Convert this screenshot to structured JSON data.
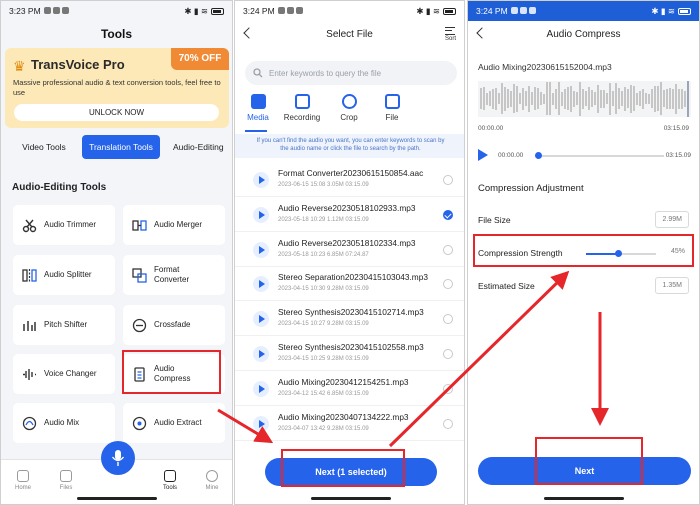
{
  "panel1": {
    "status": {
      "time": "3:23 PM",
      "battery": "battery-icon"
    },
    "title": "Tools",
    "promo": {
      "name": "TransVoice Pro",
      "badge": "70% OFF",
      "description": "Massive professional audio & text conversion tools, feel free to use",
      "button": "UNLOCK NOW"
    },
    "tabs": [
      {
        "label": "Video Tools",
        "active": false
      },
      {
        "label": "Translation Tools",
        "active": true
      },
      {
        "label": "Audio-Editing",
        "active": false
      }
    ],
    "section_heading": "Audio-Editing Tools",
    "tools": [
      {
        "label": "Audio Trimmer",
        "icon": "scissors-icon"
      },
      {
        "label": "Audio Merger",
        "icon": "merge-icon"
      },
      {
        "label": "Audio Splitter",
        "icon": "split-icon"
      },
      {
        "label": "Format Converter",
        "icon": "convert-icon"
      },
      {
        "label": "Pitch Shifter",
        "icon": "pitch-icon"
      },
      {
        "label": "Crossfade",
        "icon": "crossfade-icon"
      },
      {
        "label": "Voice Changer",
        "icon": "voice-changer-icon"
      },
      {
        "label": "Audio Compress",
        "icon": "compress-icon"
      },
      {
        "label": "Audio Mix",
        "icon": "mix-icon"
      },
      {
        "label": "Audio Extract",
        "icon": "extract-icon"
      }
    ],
    "nav": [
      {
        "label": "Home",
        "active": false
      },
      {
        "label": "Files",
        "active": false
      },
      {
        "label": "Tools",
        "active": true
      },
      {
        "label": "Mine",
        "active": false
      }
    ]
  },
  "panel2": {
    "status": {
      "time": "3:24 PM"
    },
    "title": "Select File",
    "sort_label": "Sort",
    "search_placeholder": "Enter keywords to query the file",
    "media_tabs": [
      {
        "label": "Media",
        "active": true
      },
      {
        "label": "Recording",
        "active": false
      },
      {
        "label": "Crop",
        "active": false
      },
      {
        "label": "File",
        "active": false
      }
    ],
    "hint": "If you can't find the audio you want, you can enter keywords to scan by the audio name or click the file to search by the path.",
    "files": [
      {
        "name": "Format Converter20230615150854.aac",
        "meta": "2023-06-15 15:08   3.05M   03:15.09",
        "selected": false
      },
      {
        "name": "Audio Reverse20230518102933.mp3",
        "meta": "2023-05-18 10:29   1.12M   03:15.09",
        "selected": true
      },
      {
        "name": "Audio Reverse20230518102334.mp3",
        "meta": "2023-05-18 10:23   6.85M   07:24.87",
        "selected": false
      },
      {
        "name": "Stereo Separation20230415103043.mp3",
        "meta": "2023-04-15 10:30   9.28M   03:15.09",
        "selected": false
      },
      {
        "name": "Stereo Synthesis20230415102714.mp3",
        "meta": "2023-04-15 10:27   9.28M   03:15.09",
        "selected": false
      },
      {
        "name": "Stereo Synthesis20230415102558.mp3",
        "meta": "2023-04-15 10:25   9.28M   03:15.09",
        "selected": false
      },
      {
        "name": "Audio Mixing20230412154251.mp3",
        "meta": "2023-04-12 15:42   6.85M   03:15.09",
        "selected": false
      },
      {
        "name": "Audio Mixing20230407134222.mp3",
        "meta": "2023-04-07 13:42   9.28M   03:15.09",
        "selected": false
      }
    ],
    "next_button": "Next (1 selected)"
  },
  "panel3": {
    "status": {
      "time": "3:24 PM"
    },
    "title": "Audio Compress",
    "file_name": "Audio Mixing20230615152004.mp3",
    "wave_start": "00:00.00",
    "wave_end": "03:15.09",
    "current_time": "00:00.00",
    "total_time": "03:15.09",
    "playback_progress": 0,
    "section_heading": "Compression Adjustment",
    "file_size_label": "File Size",
    "file_size_value": "2.99M",
    "strength_label": "Compression Strength",
    "strength_value": "45%",
    "strength_fraction": 0.45,
    "estimated_label": "Estimated Size",
    "estimated_value": "1.35M",
    "next_button": "Next"
  },
  "colors": {
    "accent": "#2563eb",
    "highlight": "#e5262b",
    "promo": "#fde9b8",
    "badge": "#f08a34"
  }
}
